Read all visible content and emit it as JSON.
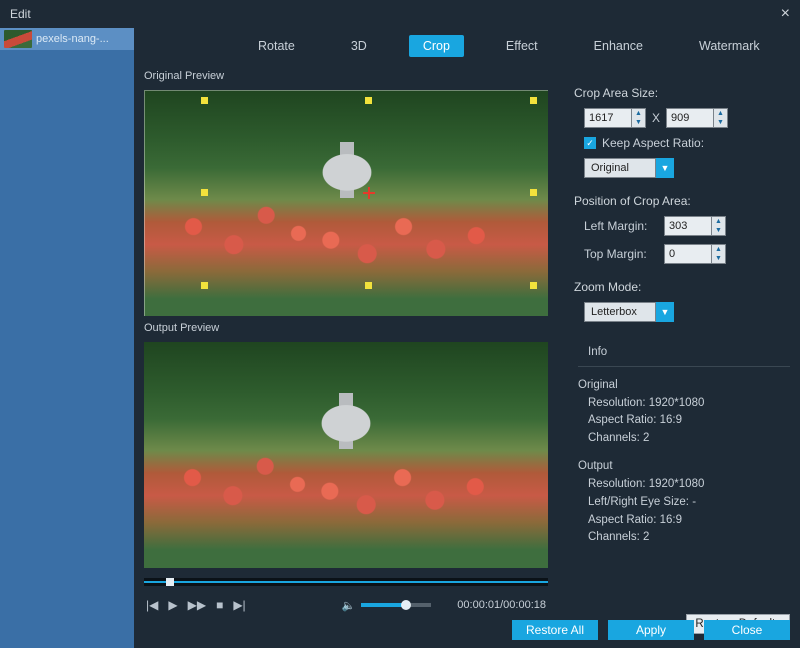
{
  "window": {
    "title": "Edit"
  },
  "sidebar": {
    "thumb_label": "pexels-nang-..."
  },
  "tabs": [
    {
      "label": "Rotate"
    },
    {
      "label": "3D"
    },
    {
      "label": "Crop"
    },
    {
      "label": "Effect"
    },
    {
      "label": "Enhance"
    },
    {
      "label": "Watermark"
    }
  ],
  "active_tab_index": 2,
  "previews": {
    "original_label": "Original Preview",
    "output_label": "Output Preview"
  },
  "player": {
    "time": "00:00:01/00:00:18"
  },
  "panel": {
    "crop_area_title": "Crop Area Size:",
    "width": "1617",
    "times": "X",
    "height": "909",
    "keep_aspect_label": "Keep Aspect Ratio:",
    "keep_aspect_checked": true,
    "aspect_dropdown": "Original",
    "position_title": "Position of Crop Area:",
    "left_margin_label": "Left Margin:",
    "left_margin": "303",
    "top_margin_label": "Top Margin:",
    "top_margin": "0",
    "zoom_title": "Zoom Mode:",
    "zoom_dropdown": "Letterbox",
    "info_header": "Info",
    "original_header": "Original",
    "original_resolution": "Resolution: 1920*1080",
    "original_aspect": "Aspect Ratio: 16:9",
    "original_channels": "Channels: 2",
    "output_header": "Output",
    "output_resolution": "Resolution: 1920*1080",
    "output_eye": "Left/Right Eye Size: -",
    "output_aspect": "Aspect Ratio: 16:9",
    "output_channels": "Channels: 2",
    "restore_defaults": "Restore Defaults"
  },
  "footer": {
    "restore_all": "Restore All",
    "apply": "Apply",
    "close": "Close"
  }
}
